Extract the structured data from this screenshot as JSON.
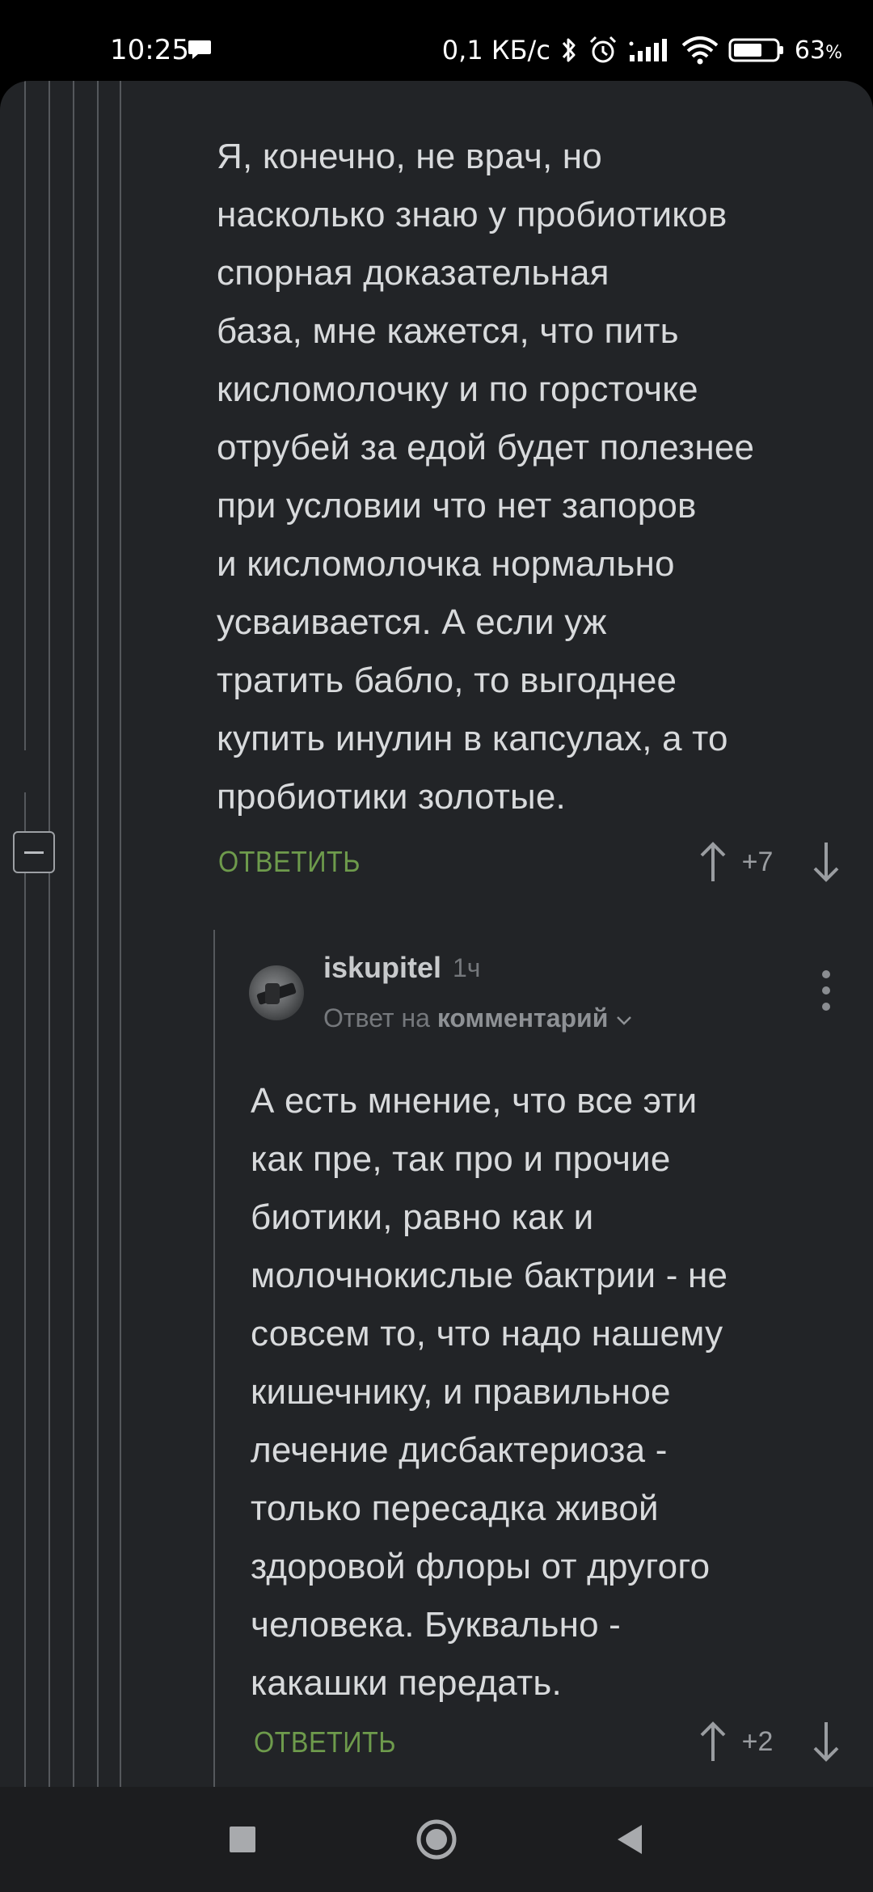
{
  "status_bar": {
    "time": "10:25",
    "network_speed": "0,1 КБ/с",
    "battery_percent": "63",
    "battery_unit": "%",
    "icons": [
      "chat-bubble-icon",
      "bluetooth-icon",
      "alarm-icon",
      "signal-icon",
      "wifi-icon",
      "battery-icon"
    ]
  },
  "comments": [
    {
      "text": "Я, конечно, не врач, но\nнасколько знаю у пробиотиков\nспорная доказательная\nбаза, мне кажется, что пить\nкисломолочку и по горсточке\nотрубей за едой будет полезнее\nпри условии что нет запоров\nи кисломолочка нормально\nусваивается. А если уж\nтратить бабло, то выгоднее\nкупить инулин в капсулах, а то\nпробиотики золотые.",
      "reply_label": "ОТВЕТИТЬ",
      "score": "+7"
    },
    {
      "username": "iskupitel",
      "time_ago": "1ч",
      "reply_to_prefix": "Ответ на",
      "reply_to_target": "комментарий",
      "text": "А есть мнение, что все эти\nкак пре, так про и прочие\nбиотики, равно как и\nмолочнокислые бактрии - не\nсовсем то, что надо нашему\nкишечнику, и правильное\nлечение дисбактериоза -\nтолько пересадка живой\nздоровой флоры от другого\nчеловека. Буквально -\nкакашки передать.",
      "reply_label": "ОТВЕТИТЬ",
      "score": "+2"
    }
  ],
  "colors": {
    "background": "#222427",
    "text": "#d8dadc",
    "reply_link": "#6e9b4c",
    "meta": "#75787c",
    "thread_line": "#55585c"
  }
}
